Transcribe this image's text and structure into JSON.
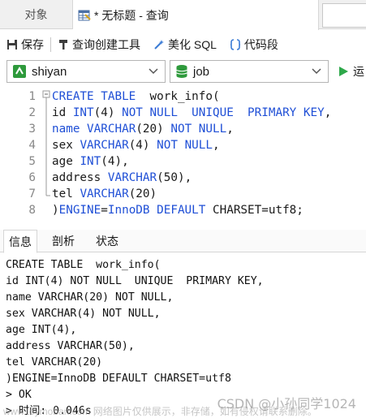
{
  "tabs": {
    "objects_label": "对象",
    "query_label": "* 无标题 - 查询"
  },
  "toolbar": {
    "save_label": "保存",
    "builder_label": "查询创建工具",
    "beautify_label": "美化 SQL",
    "snippet_label": "代码段"
  },
  "selectors": {
    "connection": "shiyan",
    "database": "job",
    "run_label": "运"
  },
  "editor": {
    "lines": [
      {
        "num": "1",
        "parts": [
          {
            "t": "CREATE TABLE",
            "c": "kw"
          },
          {
            "t": "  work_info(",
            "c": "fn"
          }
        ]
      },
      {
        "num": "2",
        "parts": [
          {
            "t": "id ",
            "c": "fn"
          },
          {
            "t": "INT",
            "c": "kw"
          },
          {
            "t": "(4) ",
            "c": "fn"
          },
          {
            "t": "NOT NULL  UNIQUE  PRIMARY KEY",
            "c": "kw"
          },
          {
            "t": ",",
            "c": "fn"
          }
        ]
      },
      {
        "num": "3",
        "parts": [
          {
            "t": "name ",
            "c": "kw"
          },
          {
            "t": "VARCHAR",
            "c": "kw"
          },
          {
            "t": "(20) ",
            "c": "fn"
          },
          {
            "t": "NOT NULL",
            "c": "kw"
          },
          {
            "t": ",",
            "c": "fn"
          }
        ]
      },
      {
        "num": "4",
        "parts": [
          {
            "t": "sex ",
            "c": "fn"
          },
          {
            "t": "VARCHAR",
            "c": "kw"
          },
          {
            "t": "(4) ",
            "c": "fn"
          },
          {
            "t": "NOT NULL",
            "c": "kw"
          },
          {
            "t": ",",
            "c": "fn"
          }
        ]
      },
      {
        "num": "5",
        "parts": [
          {
            "t": "age ",
            "c": "fn"
          },
          {
            "t": "INT",
            "c": "kw"
          },
          {
            "t": "(4),",
            "c": "fn"
          }
        ]
      },
      {
        "num": "6",
        "parts": [
          {
            "t": "address ",
            "c": "fn"
          },
          {
            "t": "VARCHAR",
            "c": "kw"
          },
          {
            "t": "(50),",
            "c": "fn"
          }
        ]
      },
      {
        "num": "7",
        "parts": [
          {
            "t": "tel ",
            "c": "fn"
          },
          {
            "t": "VARCHAR",
            "c": "kw"
          },
          {
            "t": "(20)",
            "c": "fn"
          }
        ]
      },
      {
        "num": "8",
        "parts": [
          {
            "t": ")",
            "c": "fn"
          },
          {
            "t": "ENGINE",
            "c": "kw"
          },
          {
            "t": "=",
            "c": "fn"
          },
          {
            "t": "InnoDB DEFAULT",
            "c": "kw"
          },
          {
            "t": " CHARSET=utf8;",
            "c": "fn"
          }
        ]
      }
    ]
  },
  "panel": {
    "tabs": [
      "信息",
      "剖析",
      "状态"
    ],
    "output": [
      "CREATE TABLE  work_info(",
      "id INT(4) NOT NULL  UNIQUE  PRIMARY KEY,",
      "name VARCHAR(20) NOT NULL,",
      "sex VARCHAR(4) NOT NULL,",
      "age INT(4),",
      "address VARCHAR(50),",
      "tel VARCHAR(20)",
      ")ENGINE=InnoDB DEFAULT CHARSET=utf8",
      "> OK",
      "> 时间: 0.046s"
    ]
  },
  "watermarks": {
    "csdn": "CSDN @小孙同学1024",
    "toy": "www.toymoban.com 网络图片仅供展示，非存储，如有侵权请联系删除。"
  },
  "colors": {
    "keyword": "#1f4fd6",
    "connection_icon": "#2e9a3c",
    "db_icon": "#2e9a3c",
    "run_icon": "#2ea84a"
  }
}
